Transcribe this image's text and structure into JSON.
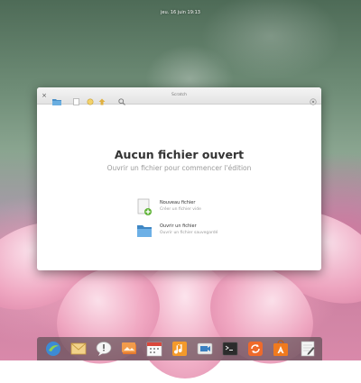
{
  "topbar": {
    "datetime": "jeu. 16 juin    19:13"
  },
  "window": {
    "title": "Scratch",
    "heading": "Aucun fichier ouvert",
    "subheading": "Ouvrir un fichier pour commencer l'édition",
    "actions": [
      {
        "title": "Nouveau fichier",
        "subtitle": "Créer un fichier vide"
      },
      {
        "title": "Ouvrir un fichier",
        "subtitle": "Ouvrir un fichier sauvegardé"
      }
    ]
  },
  "dock": {
    "items": [
      "midori-icon",
      "mail-icon",
      "chat-icon",
      "photos-icon",
      "calendar-icon",
      "music-icon",
      "videos-icon",
      "terminal-icon",
      "update-icon",
      "software-center-icon",
      "scratch-icon"
    ]
  }
}
